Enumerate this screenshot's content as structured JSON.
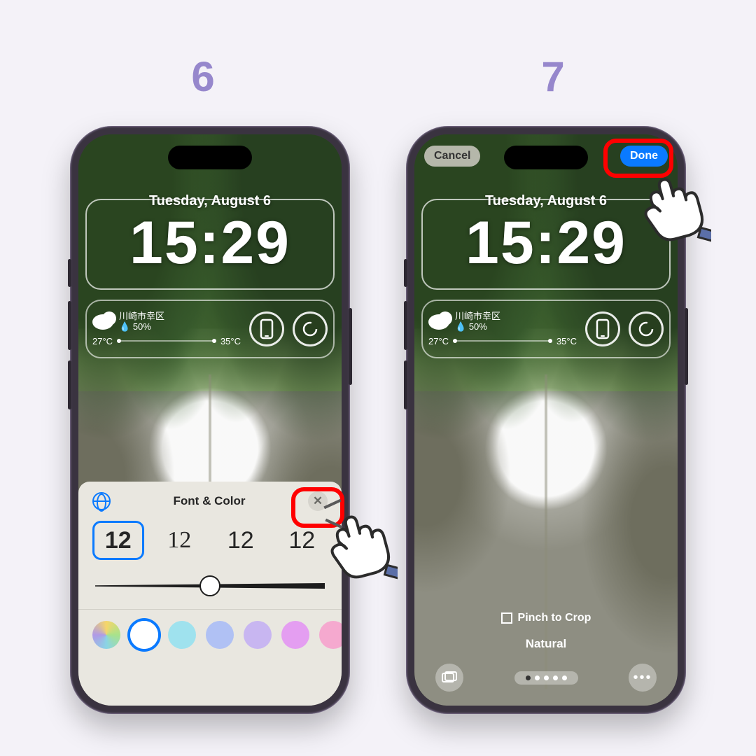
{
  "steps": {
    "left": "6",
    "right": "7"
  },
  "lock": {
    "date": "Tuesday, August 6",
    "time": "15:29",
    "weather": {
      "location": "川崎市幸区",
      "humidity": "50%",
      "low": "27°C",
      "high": "35°C"
    }
  },
  "sheet": {
    "title": "Font & Color",
    "font_samples": [
      "12",
      "12",
      "12",
      "12"
    ]
  },
  "right_phone": {
    "cancel": "Cancel",
    "done": "Done",
    "crop_hint": "Pinch to Crop",
    "style": "Natural"
  },
  "colors": {
    "accent": "#0a7aff",
    "callout": "#ff0000",
    "step": "#9687cc"
  }
}
